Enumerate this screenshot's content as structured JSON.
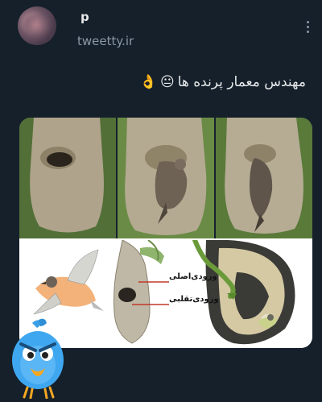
{
  "user": {
    "name": "p",
    "handle": "tweetty.ir"
  },
  "post": {
    "text": "مهندس معمار پرنده ها",
    "emojis": [
      "😐",
      "👌"
    ]
  },
  "diagram": {
    "label_main_entrance": "ورودی‌اصلی",
    "label_fake_entrance": "ورودی‌تقلبی"
  },
  "icons": {
    "menu": "more-vertical-icon",
    "mascot": "twitter-bird-mascot"
  },
  "colors": {
    "background": "#15202b",
    "text": "#e7e9ea",
    "muted": "#8b98a5"
  }
}
